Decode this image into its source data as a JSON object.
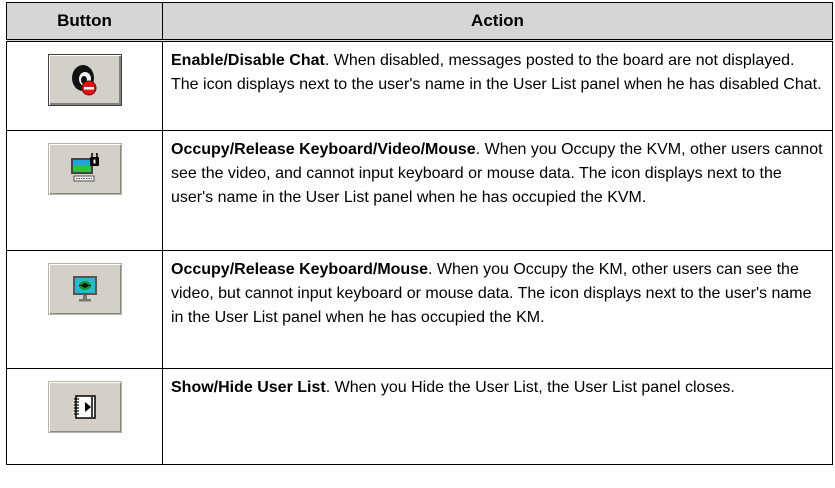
{
  "table": {
    "headers": {
      "button": "Button",
      "action": "Action"
    },
    "rows": [
      {
        "icon": "chat-head-disable-icon",
        "title": "Enable/Disable Chat",
        "description": ". When disabled, messages posted to the board are not displayed. The icon displays next to the user's name in the User List panel when he has disabled Chat."
      },
      {
        "icon": "monitor-keyboard-lock-icon",
        "title": "Occupy/Release Keyboard/Video/Mouse",
        "description": ". When you Occupy the KVM, other users cannot see the video, and cannot input keyboard or mouse data. The icon displays next to the user's name in the User List panel when he has occupied the KVM."
      },
      {
        "icon": "monitor-mouse-icon",
        "title": "Occupy/Release Keyboard/Mouse",
        "description": ". When you Occupy the KM, other users can see the video, but cannot input keyboard or mouse data. The icon displays next to the user's name in the User List panel when he has occupied the KM."
      },
      {
        "icon": "user-list-toggle-icon",
        "title": "Show/Hide User List",
        "description": ". When you Hide the User List, the User List panel closes."
      }
    ]
  },
  "colors": {
    "header_bg": "#d6d6d6",
    "button_face": "#d4d0c8",
    "border": "#000000"
  }
}
